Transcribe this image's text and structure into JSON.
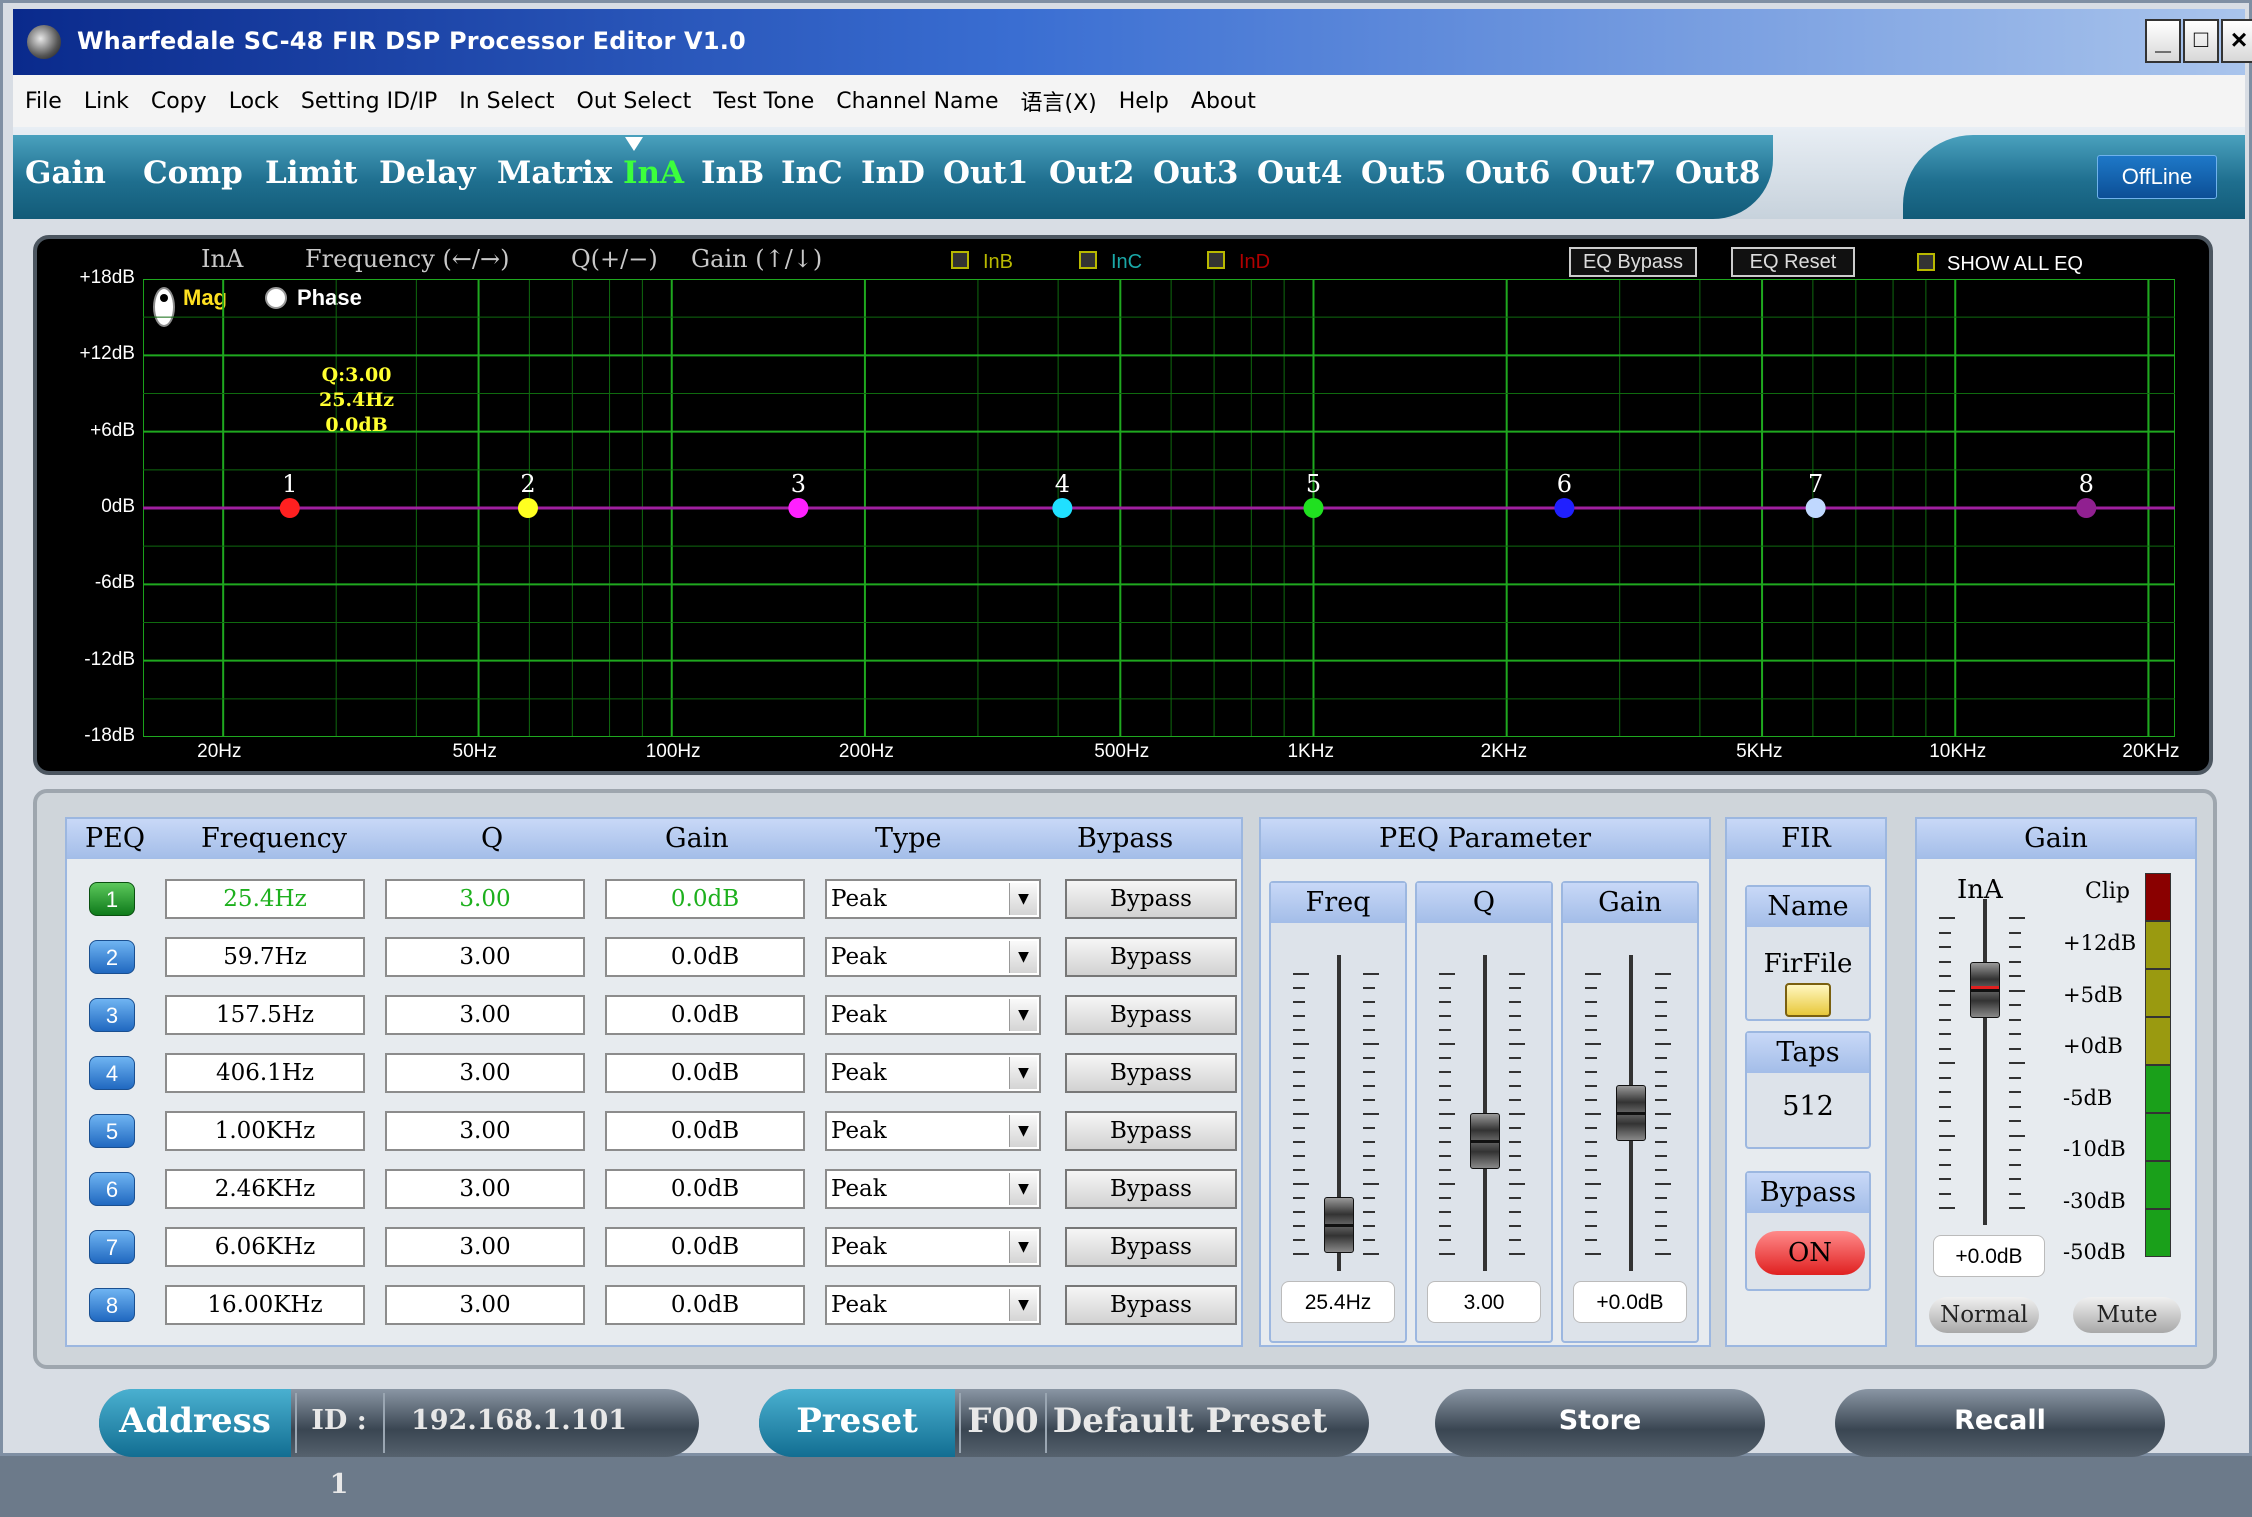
{
  "window": {
    "title": "Wharfedale SC-48 FIR DSP Processor Editor V1.0"
  },
  "menu": [
    "File",
    "Link",
    "Copy",
    "Lock",
    "Setting ID/IP",
    "In Select",
    "Out Select",
    "Test Tone",
    "Channel Name",
    "语言(X)",
    "Help",
    "About"
  ],
  "tabs": [
    "Gain",
    "Comp",
    "Limit",
    "Delay",
    "Matrix",
    "InA",
    "InB",
    "InC",
    "InD",
    "Out1",
    "Out2",
    "Out3",
    "Out4",
    "Out5",
    "Out6",
    "Out7",
    "Out8"
  ],
  "active_tab": "InA",
  "status": "OffLine",
  "graph": {
    "channel": "InA",
    "freq_hint": "Frequency (←/→)",
    "q_hint": "Q(+/−)",
    "gain_hint": "Gain (↑/↓)",
    "overlay_checks": [
      {
        "label": "InB",
        "color": "#b8b800"
      },
      {
        "label": "InC",
        "color": "#1aa8a8"
      },
      {
        "label": "InD",
        "color": "#b00000"
      }
    ],
    "eq_bypass": "EQ Bypass",
    "eq_reset": "EQ Reset",
    "show_all": "SHOW ALL EQ",
    "mag": "Mag",
    "phase": "Phase",
    "y_ticks": [
      "+18dB",
      "+12dB",
      "+6dB",
      "0dB",
      "-6dB",
      "-12dB",
      "-18dB"
    ],
    "x_ticks": [
      "20Hz",
      "50Hz",
      "100Hz",
      "200Hz",
      "500Hz",
      "1KHz",
      "2KHz",
      "5KHz",
      "10KHz",
      "20KHz"
    ],
    "annotation": {
      "q": "Q:3.00",
      "freq": "25.4Hz",
      "gain": "0.0dB"
    },
    "curve_color": "#a020a0",
    "points": [
      {
        "n": "1",
        "freq": 25.4,
        "color": "#ff2020"
      },
      {
        "n": "2",
        "freq": 59.7,
        "color": "#ffff20"
      },
      {
        "n": "3",
        "freq": 157.5,
        "color": "#ff20ff"
      },
      {
        "n": "4",
        "freq": 406.1,
        "color": "#20e0ff"
      },
      {
        "n": "5",
        "freq": 1000,
        "color": "#20e020"
      },
      {
        "n": "6",
        "freq": 2460,
        "color": "#2020ff"
      },
      {
        "n": "7",
        "freq": 6060,
        "color": "#c0d8ff"
      },
      {
        "n": "8",
        "freq": 16000,
        "color": "#902090"
      }
    ]
  },
  "peq": {
    "headers": {
      "peq": "PEQ",
      "frequency": "Frequency",
      "q": "Q",
      "gain": "Gain",
      "type": "Type",
      "bypass": "Bypass"
    },
    "rows": [
      {
        "n": "1",
        "freq": "25.4Hz",
        "q": "3.00",
        "gain": "0.0dB",
        "type": "Peak",
        "bypass": "Bypass"
      },
      {
        "n": "2",
        "freq": "59.7Hz",
        "q": "3.00",
        "gain": "0.0dB",
        "type": "Peak",
        "bypass": "Bypass"
      },
      {
        "n": "3",
        "freq": "157.5Hz",
        "q": "3.00",
        "gain": "0.0dB",
        "type": "Peak",
        "bypass": "Bypass"
      },
      {
        "n": "4",
        "freq": "406.1Hz",
        "q": "3.00",
        "gain": "0.0dB",
        "type": "Peak",
        "bypass": "Bypass"
      },
      {
        "n": "5",
        "freq": "1.00KHz",
        "q": "3.00",
        "gain": "0.0dB",
        "type": "Peak",
        "bypass": "Bypass"
      },
      {
        "n": "6",
        "freq": "2.46KHz",
        "q": "3.00",
        "gain": "0.0dB",
        "type": "Peak",
        "bypass": "Bypass"
      },
      {
        "n": "7",
        "freq": "6.06KHz",
        "q": "3.00",
        "gain": "0.0dB",
        "type": "Peak",
        "bypass": "Bypass"
      },
      {
        "n": "8",
        "freq": "16.00KHz",
        "q": "3.00",
        "gain": "0.0dB",
        "type": "Peak",
        "bypass": "Bypass"
      }
    ]
  },
  "param": {
    "title": "PEQ Parameter",
    "freq": {
      "label": "Freq",
      "value": "25.4Hz",
      "level": 0.1
    },
    "q": {
      "label": "Q",
      "value": "3.00",
      "level": 0.4
    },
    "gain": {
      "label": "Gain",
      "value": "+0.0dB",
      "level": 0.5
    }
  },
  "fir": {
    "title": "FIR",
    "name_label": "Name",
    "name_value": "FirFile",
    "taps_label": "Taps",
    "taps_value": "512",
    "bypass_label": "Bypass",
    "bypass_value": "ON"
  },
  "gain": {
    "title": "Gain",
    "channel": "InA",
    "clip": "Clip",
    "value": "+0.0dB",
    "level": 0.75,
    "meter_labels": [
      "+12dB",
      "+5dB",
      "+0dB",
      "-5dB",
      "-10dB",
      "-30dB",
      "-50dB"
    ],
    "normal": "Normal",
    "mute": "Mute"
  },
  "footer": {
    "address": "Address",
    "id": "ID : 1",
    "ip": "192.168.1.101",
    "preset": "Preset",
    "preset_code": "F00",
    "preset_name": "Default Preset",
    "store": "Store",
    "recall": "Recall"
  }
}
